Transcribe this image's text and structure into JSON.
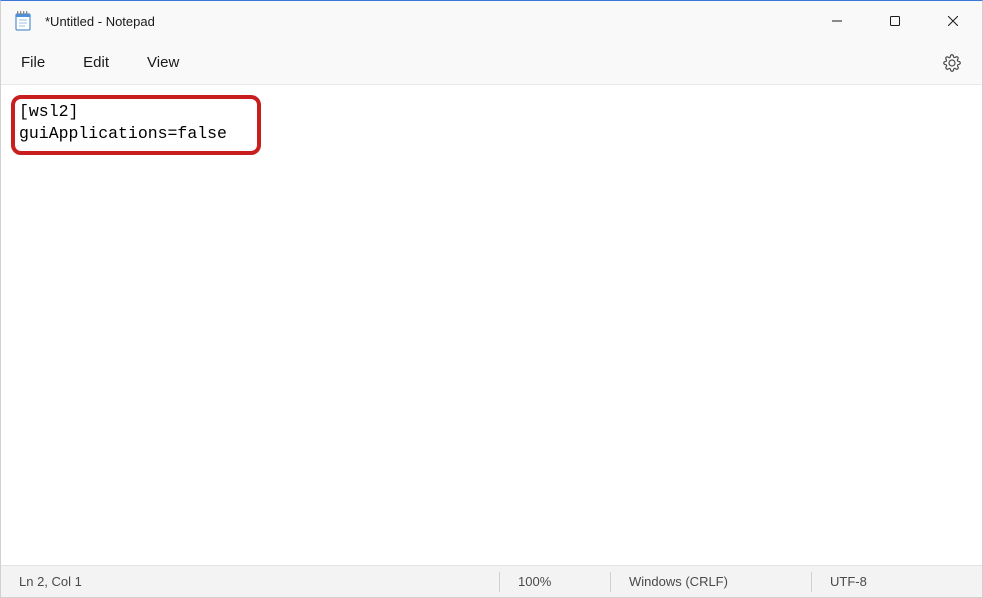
{
  "window": {
    "title": "*Untitled - Notepad"
  },
  "menubar": {
    "file": "File",
    "edit": "Edit",
    "view": "View"
  },
  "editor": {
    "content": "[wsl2]\nguiApplications=false"
  },
  "statusbar": {
    "position": "Ln 2, Col 1",
    "zoom": "100%",
    "line_ending": "Windows (CRLF)",
    "encoding": "UTF-8"
  }
}
